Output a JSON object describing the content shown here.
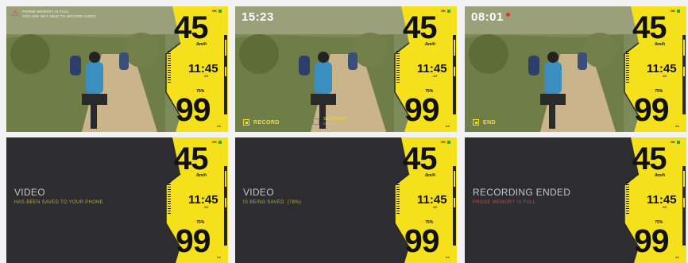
{
  "hud": {
    "status_ok": "OK",
    "speed": "45",
    "speed_unit": "/km/h",
    "time": "11:45",
    "am_pm": "AM",
    "battery_pct": "75%",
    "battery_big": "99",
    "battery_unit": "km"
  },
  "screens": [
    {
      "warning_line1": "PHONE MEMORY IS FULL",
      "warning_line2": "YOU ARE NOT ABLE TO RECORD VIDEO"
    },
    {
      "clock": "15:23",
      "record_label": "RECORD",
      "snap_label": "SNAPSHOT",
      "snap_sub": "CAMERA"
    },
    {
      "clock": "08:01",
      "end_label": "END"
    },
    {
      "title": "VIDEO",
      "subtitle": "HAS BEEN SAVED TO YOUR PHONE"
    },
    {
      "title": "VIDEO",
      "subtitle": "IS BEING SAVED  (78%)"
    },
    {
      "title": "RECORDING ENDED",
      "subtitle": "PHONE MEMORY IS FULL"
    }
  ],
  "colors": {
    "accent": "#f5e11b",
    "subtitle": "#bfae1d",
    "error": "#c84a42",
    "dark_bg": "#2c2c31"
  },
  "icons": [
    "warning-icon",
    "record-icon",
    "snapshot-icon",
    "stop-icon",
    "bike-icon"
  ]
}
